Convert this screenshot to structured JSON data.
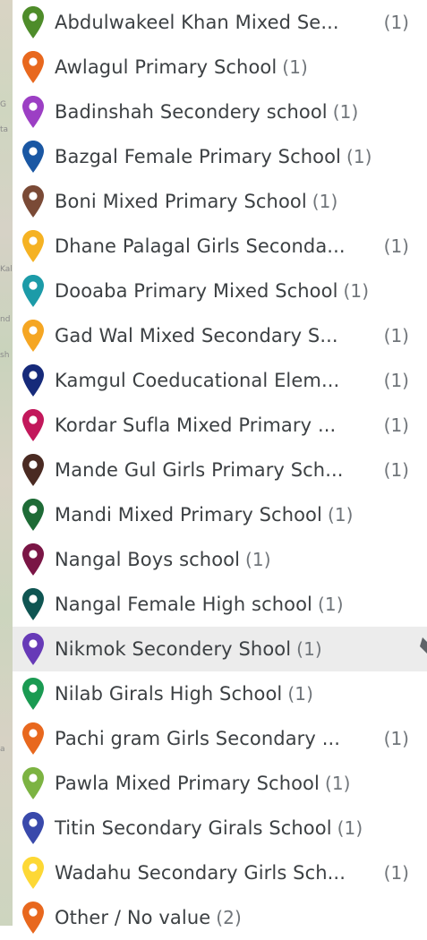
{
  "map_fragments": [
    "G",
    "ta",
    "Kal",
    "nd",
    "sh",
    "a"
  ],
  "items": [
    {
      "label": "Abdulwakeel Khan Mixed Se...",
      "count": "(1)",
      "color": "#4e8c2a",
      "count_inline": false
    },
    {
      "label": "Awlagul Primary School",
      "count": "(1)",
      "color": "#e8681e",
      "count_inline": true
    },
    {
      "label": "Badinshah Secondery school",
      "count": "(1)",
      "color": "#9c3fc4",
      "count_inline": true
    },
    {
      "label": "Bazgal Female Primary School",
      "count": "(1)",
      "color": "#1a57a3",
      "count_inline": true
    },
    {
      "label": "Boni Mixed Primary School",
      "count": "(1)",
      "color": "#7a4a36",
      "count_inline": true
    },
    {
      "label": "Dhane Palagal Girls Seconda...",
      "count": "(1)",
      "color": "#f5b223",
      "count_inline": false
    },
    {
      "label": "Dooaba Primary Mixed School",
      "count": "(1)",
      "color": "#1c9ba8",
      "count_inline": true
    },
    {
      "label": "Gad Wal Mixed Secondary S...",
      "count": "(1)",
      "color": "#f5a623",
      "count_inline": false
    },
    {
      "label": "Kamgul Coeducational Elem...",
      "count": "(1)",
      "color": "#162a7a",
      "count_inline": false
    },
    {
      "label": "Kordar Sufla Mixed Primary ...",
      "count": "(1)",
      "color": "#c2185b",
      "count_inline": false
    },
    {
      "label": "Mande Gul Girls Primary Sch...",
      "count": "(1)",
      "color": "#4a2a22",
      "count_inline": false
    },
    {
      "label": "Mandi Mixed Primary School",
      "count": "(1)",
      "color": "#1e6b36",
      "count_inline": true
    },
    {
      "label": "Nangal Boys school",
      "count": "(1)",
      "color": "#7a1545",
      "count_inline": true
    },
    {
      "label": "Nangal Female High school",
      "count": "(1)",
      "color": "#0f5552",
      "count_inline": true
    },
    {
      "label": "Nikmok Secondery Shool",
      "count": "(1)",
      "color": "#673ab7",
      "count_inline": true,
      "hover": true
    },
    {
      "label": "Nilab Girals High School",
      "count": "(1)",
      "color": "#1a9a52",
      "count_inline": true
    },
    {
      "label": "Pachi gram Girls Secondary ...",
      "count": "(1)",
      "color": "#e8681e",
      "count_inline": false
    },
    {
      "label": "Pawla Mixed Primary School",
      "count": "(1)",
      "color": "#7cb342",
      "count_inline": true
    },
    {
      "label": "Titin Secondary Girals School",
      "count": "(1)",
      "color": "#3949ab",
      "count_inline": true
    },
    {
      "label": "Wadahu Secondary Girls Sch...",
      "count": "(1)",
      "color": "#fdd835",
      "count_inline": false
    },
    {
      "label": "Other / No value",
      "count": "(2)",
      "color": "#e8681e",
      "count_inline": true
    }
  ]
}
